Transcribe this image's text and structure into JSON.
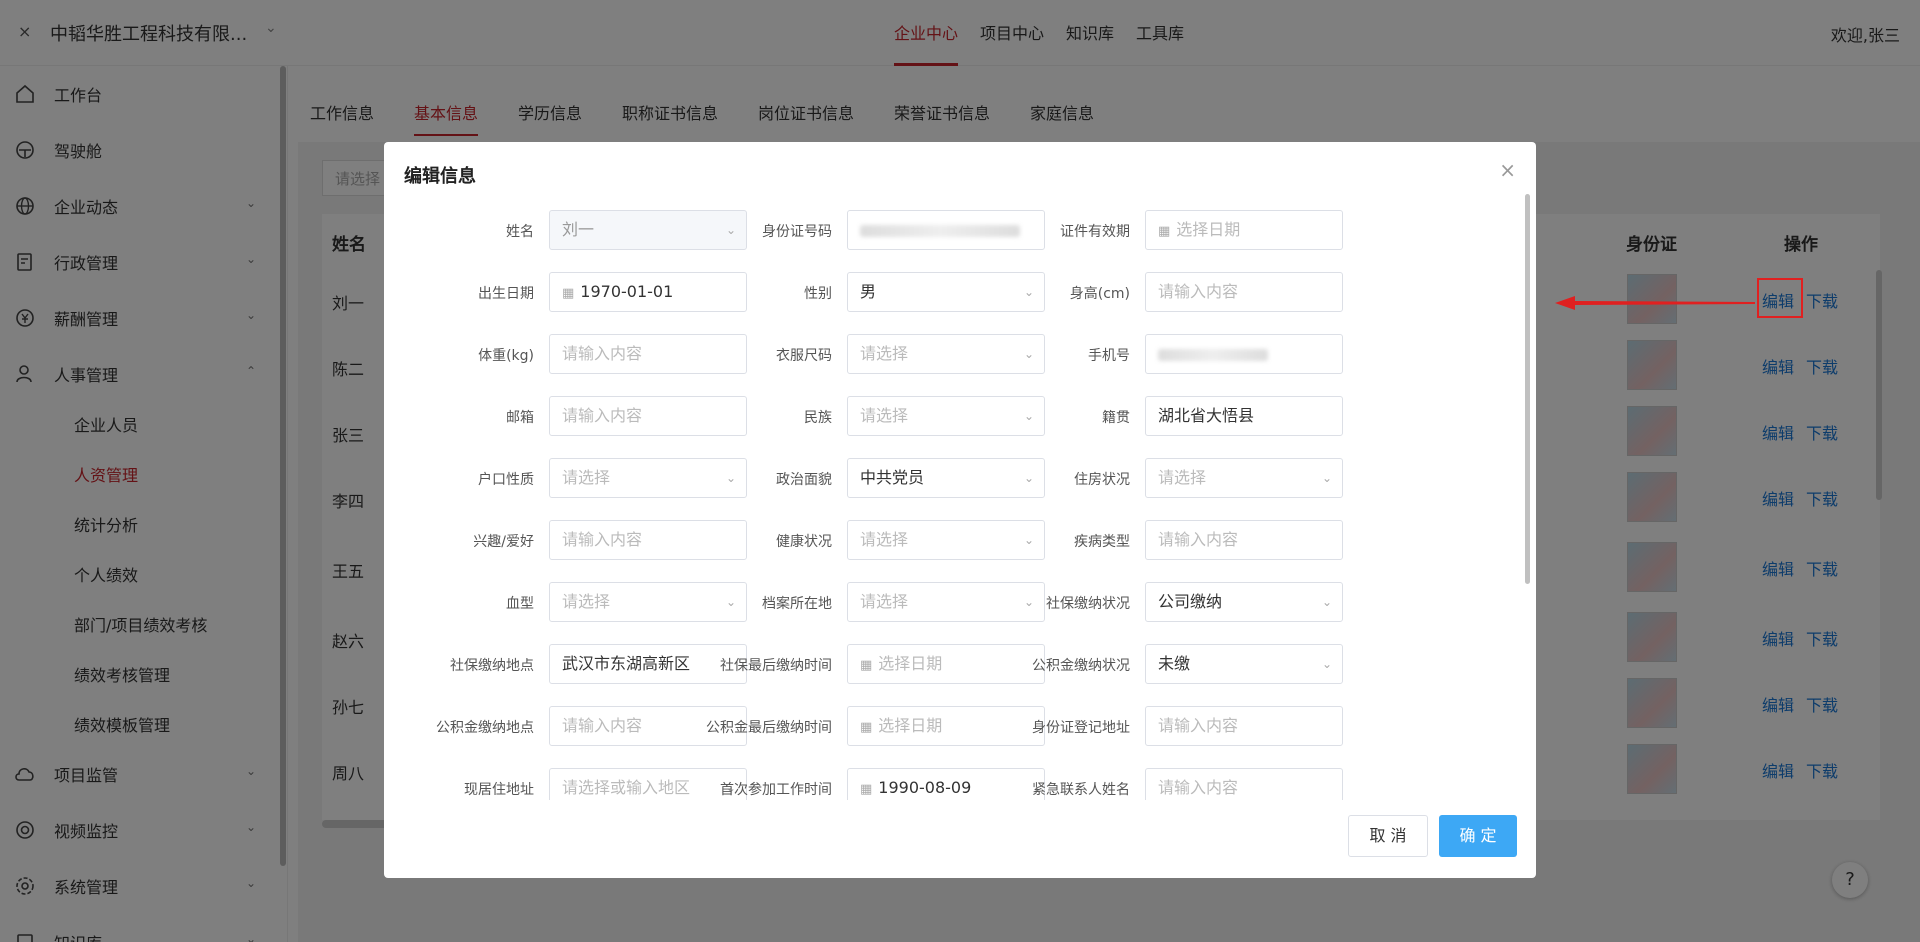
{
  "header": {
    "close_glyph": "×",
    "company": "中韬华胜工程科技有限...",
    "nav": [
      "企业中心",
      "项目中心",
      "知识库",
      "工具库"
    ],
    "welcome": "欢迎,张三"
  },
  "sidebar": {
    "items": [
      {
        "label": "工作台",
        "icon": "home-icon"
      },
      {
        "label": "驾驶舱",
        "icon": "dashboard-icon"
      },
      {
        "label": "企业动态",
        "icon": "globe-icon"
      },
      {
        "label": "行政管理",
        "icon": "admin-icon"
      },
      {
        "label": "薪酬管理",
        "icon": "salary-icon"
      },
      {
        "label": "人事管理",
        "icon": "user-icon"
      },
      {
        "label": "项目监管",
        "icon": "cloud-icon"
      },
      {
        "label": "视频监控",
        "icon": "camera-icon"
      },
      {
        "label": "系统管理",
        "icon": "gear-icon"
      },
      {
        "label": "知识库",
        "icon": "book-icon"
      }
    ],
    "sub_items": [
      "企业人员",
      "人资管理",
      "统计分析",
      "个人绩效",
      "部门/项目绩效考核",
      "绩效考核管理",
      "绩效模板管理"
    ]
  },
  "tabs": [
    "工作信息",
    "基本信息",
    "学历信息",
    "职称证书信息",
    "岗位证书信息",
    "荣誉证书信息",
    "家庭信息"
  ],
  "filter": {
    "placeholder": "请选择"
  },
  "table": {
    "headers": {
      "name": "姓名",
      "id_card": "身份证",
      "action": "操作"
    },
    "rows": [
      "刘一",
      "陈二",
      "张三",
      "李四",
      "王五",
      "赵六",
      "孙七",
      "周八"
    ],
    "edit_label": "编辑",
    "download_label": "下载"
  },
  "help": "?",
  "dialog": {
    "title": "编辑信息",
    "close_glyph": "×",
    "fields": [
      {
        "label": "姓名",
        "value": "刘一",
        "kind": "select-disabled"
      },
      {
        "label": "身份证号码",
        "value": "",
        "kind": "blur"
      },
      {
        "label": "证件有效期",
        "placeholder": "选择日期",
        "kind": "date"
      },
      {
        "label": "出生日期",
        "value": "1970-01-01",
        "kind": "date"
      },
      {
        "label": "性别",
        "value": "男",
        "kind": "select"
      },
      {
        "label": "身高(cm)",
        "placeholder": "请输入内容",
        "kind": "input"
      },
      {
        "label": "体重(kg)",
        "placeholder": "请输入内容",
        "kind": "input"
      },
      {
        "label": "衣服尺码",
        "placeholder": "请选择",
        "kind": "select"
      },
      {
        "label": "手机号",
        "value": "",
        "kind": "blur-short"
      },
      {
        "label": "邮箱",
        "placeholder": "请输入内容",
        "kind": "input"
      },
      {
        "label": "民族",
        "placeholder": "请选择",
        "kind": "select"
      },
      {
        "label": "籍贯",
        "value": "湖北省大悟县",
        "kind": "input"
      },
      {
        "label": "户口性质",
        "placeholder": "请选择",
        "kind": "select"
      },
      {
        "label": "政治面貌",
        "value": "中共党员",
        "kind": "select"
      },
      {
        "label": "住房状况",
        "placeholder": "请选择",
        "kind": "select"
      },
      {
        "label": "兴趣/爱好",
        "placeholder": "请输入内容",
        "kind": "input"
      },
      {
        "label": "健康状况",
        "placeholder": "请选择",
        "kind": "select"
      },
      {
        "label": "疾病类型",
        "placeholder": "请输入内容",
        "kind": "input"
      },
      {
        "label": "血型",
        "placeholder": "请选择",
        "kind": "select"
      },
      {
        "label": "档案所在地",
        "placeholder": "请选择",
        "kind": "select"
      },
      {
        "label": "社保缴纳状况",
        "value": "公司缴纳",
        "kind": "select"
      },
      {
        "label": "社保缴纳地点",
        "value": "武汉市东湖高新区",
        "kind": "input"
      },
      {
        "label": "社保最后缴纳时间",
        "placeholder": "选择日期",
        "kind": "date"
      },
      {
        "label": "公积金缴纳状况",
        "value": "未缴",
        "kind": "select"
      },
      {
        "label": "公积金缴纳地点",
        "placeholder": "请输入内容",
        "kind": "input"
      },
      {
        "label": "公积金最后缴纳时间",
        "placeholder": "选择日期",
        "kind": "date"
      },
      {
        "label": "身份证登记地址",
        "placeholder": "请输入内容",
        "kind": "input"
      },
      {
        "label": "现居住地址",
        "placeholder": "请选择或输入地区",
        "kind": "select"
      },
      {
        "label": "首次参加工作时间",
        "value": "1990-08-09",
        "kind": "date"
      },
      {
        "label": "紧急联系人姓名",
        "placeholder": "请输入内容",
        "kind": "input"
      }
    ],
    "cancel_label": "取 消",
    "ok_label": "确 定"
  },
  "colors": {
    "brand": "#c8252c",
    "link": "#1b78d6",
    "primary": "#3da8f5"
  }
}
